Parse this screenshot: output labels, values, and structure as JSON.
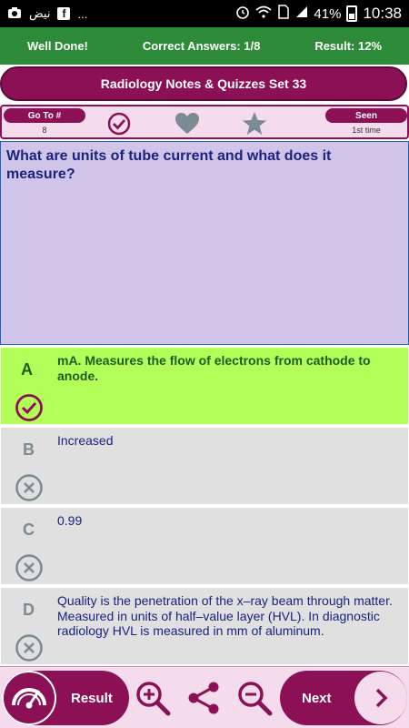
{
  "status_bar": {
    "carrier_text": "نيض",
    "signal": "...",
    "battery": "41%",
    "time": "10:38"
  },
  "score": {
    "well_done": "Well Done!",
    "correct_answers": "Correct Answers: 1/8",
    "result": "Result: 12%"
  },
  "title": "Radiology Notes & Quizzes Set 33",
  "controls": {
    "goto_label": "Go To #",
    "goto_value": "8",
    "seen_label": "Seen",
    "seen_value": "1st time"
  },
  "question": "What are units of tube current and what does it measure?",
  "answers": [
    {
      "letter": "A",
      "text": "mA. Measures the flow of electrons from cathode to anode.",
      "state": "correct"
    },
    {
      "letter": "B",
      "text": "Increased",
      "state": "wrong"
    },
    {
      "letter": "C",
      "text": "0.99",
      "state": "wrong"
    },
    {
      "letter": "D",
      "text": "Quality is the penetration of the x–ray beam through matter. Measured in units of half–value layer (HVL). In diagnostic radiology HVL is measured in mm of aluminum.",
      "state": "wrong"
    }
  ],
  "bottom": {
    "result_label": "Result",
    "next_label": "Next"
  },
  "colors": {
    "brand": "#8c1055",
    "score_bar": "#2e8b3a",
    "correct_bg": "#b2ff59",
    "question_bg": "#d1c4e9"
  }
}
